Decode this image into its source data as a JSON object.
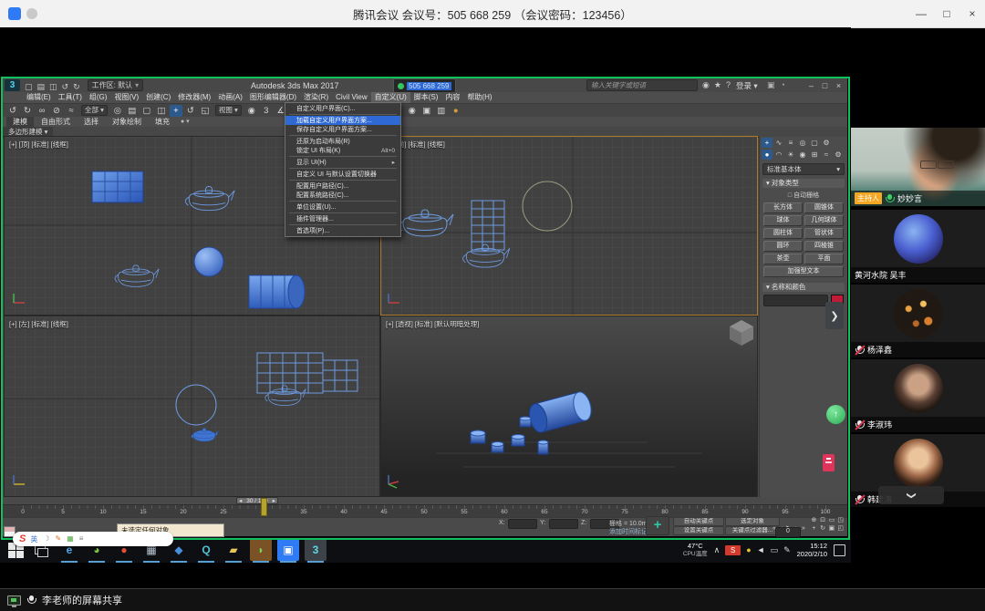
{
  "window": {
    "title": "腾讯会议 会议号：505 668 259 （会议密码：123456）",
    "controls": [
      {
        "n": "window-minimize-button",
        "g": "—"
      },
      {
        "n": "window-maximize-button",
        "g": "□"
      },
      {
        "n": "window-close-button",
        "g": "×"
      }
    ]
  },
  "share_bar": {
    "label": "李老师的屏幕共享"
  },
  "sidebar": {
    "participants": [
      {
        "name": "妙妙言",
        "badge": "主持人",
        "mic": "on",
        "kind": "video"
      },
      {
        "name": "黄河水院 吴丰",
        "mic": "none",
        "kind": "avatar",
        "avatar": "av1"
      },
      {
        "name": "杨泽鑫",
        "mic": "muted",
        "kind": "avatar",
        "avatar": "av2"
      },
      {
        "name": "李淑玮",
        "mic": "muted",
        "kind": "avatar",
        "avatar": "av3"
      },
      {
        "name": "韩建涛",
        "mic": "muted",
        "kind": "avatar",
        "avatar": "av4"
      }
    ],
    "expander_icon": "❯",
    "more_icon": "❯"
  },
  "max": {
    "title": "Autodesk 3ds Max 2017",
    "workspace": "工作区: 默认",
    "share_pill": "505 668 259",
    "search_placeholder": "输入关键字或短语",
    "signin": "登录 ▾",
    "quick_icons": [
      {
        "n": "new-file-icon",
        "g": "▢"
      },
      {
        "n": "open-file-icon",
        "g": "▤"
      },
      {
        "n": "save-file-icon",
        "g": "◫"
      },
      {
        "n": "undo-qat-icon",
        "g": "↺"
      },
      {
        "n": "redo-qat-icon",
        "g": "↻"
      }
    ],
    "account_icons": [
      {
        "n": "user-icon",
        "g": "◉"
      },
      {
        "n": "favorites-icon",
        "g": "★"
      },
      {
        "n": "help-icon",
        "g": "?"
      }
    ],
    "helper_icons": [
      {
        "n": "workspace-switcher-icon",
        "g": "▣"
      },
      {
        "n": "infocenter-icon",
        "g": "◔"
      }
    ],
    "window_controls": [
      {
        "n": "max-minimize-button",
        "g": "–"
      },
      {
        "n": "max-maximize-button",
        "g": "□"
      },
      {
        "n": "max-close-button",
        "g": "×"
      }
    ],
    "menubar": [
      "编辑(E)",
      "工具(T)",
      "组(G)",
      "视图(V)",
      "创建(C)",
      "修改器(M)",
      "动画(A)",
      "图形编辑器(D)",
      "渲染(R)",
      "Civil View",
      "自定义(U)",
      "脚本(S)",
      "内容",
      "帮助(H)"
    ],
    "open_menu_index": 10,
    "toolbar": [
      {
        "n": "undo-icon",
        "g": "↺"
      },
      {
        "n": "redo-icon",
        "g": "↻"
      },
      {
        "n": "select-and-link-icon",
        "g": "∞"
      },
      {
        "n": "unlink-selection-icon",
        "g": "⊘"
      },
      {
        "n": "bind-to-spacewarp-icon",
        "g": "≈"
      },
      {
        "n": "selection-filter-dropdown",
        "g": "全部",
        "dd": 1
      },
      {
        "n": "select-object-icon",
        "g": "◎"
      },
      {
        "n": "select-by-name-icon",
        "g": "▤"
      },
      {
        "n": "rectangular-region-icon",
        "g": "▢"
      },
      {
        "n": "window-crossing-icon",
        "g": "◫"
      },
      {
        "n": "select-and-move-icon",
        "g": "+",
        "hl": 1
      },
      {
        "n": "select-and-rotate-icon",
        "g": "↺"
      },
      {
        "n": "select-and-scale-icon",
        "g": "◱"
      },
      {
        "n": "reference-coordinate-dropdown",
        "g": "视图",
        "dd": 1
      },
      {
        "n": "use-pivot-icon",
        "g": "◉"
      },
      {
        "n": "snaps-toggle-icon",
        "g": "3"
      },
      {
        "n": "angle-snap-icon",
        "g": "∡"
      },
      {
        "n": "percent-snap-icon",
        "g": "%"
      },
      {
        "n": "named-selection-icon",
        "g": "▦"
      },
      {
        "n": "mirror-icon",
        "g": "◨"
      },
      {
        "n": "align-icon",
        "g": "≡"
      },
      {
        "n": "layer-manager-icon",
        "g": "▥"
      },
      {
        "n": "ribbon-toggle-icon",
        "g": "▬"
      },
      {
        "n": "curve-editor-icon",
        "g": "∿"
      },
      {
        "n": "schematic-view-icon",
        "g": "⊞"
      },
      {
        "n": "material-editor-icon",
        "g": "◉"
      },
      {
        "n": "render-setup-icon",
        "g": "▣"
      },
      {
        "n": "rendered-frame-icon",
        "g": "▥"
      },
      {
        "n": "render-production-icon",
        "g": "●",
        "c": "#d49a3a"
      }
    ],
    "ribbon_tabs": [
      "建模",
      "自由形式",
      "选择",
      "对象绘制",
      "填充"
    ],
    "ribbon_panel": "多边形建模 ▾",
    "customize_menu": [
      {
        "label": "自定义用户界面(C)...",
        "sep_after": true
      },
      {
        "label": "加载自定义用户界面方案...",
        "highlight": true
      },
      {
        "label": "保存自定义用户界面方案...",
        "sep_after": true
      },
      {
        "label": "还原为启动布局(R)"
      },
      {
        "label": "锁定 UI 布局(K)",
        "shortcut": "Alt+0",
        "sep_after": true
      },
      {
        "label": "显示 UI(H)",
        "submenu": true,
        "sep_after": true
      },
      {
        "label": "自定义 UI 与默认设置切换器",
        "sep_after": true
      },
      {
        "label": "配置用户路径(C)..."
      },
      {
        "label": "配置系统路径(C)...",
        "sep_after": true
      },
      {
        "label": "单位设置(U)...",
        "sep_after": true
      },
      {
        "label": "插件管理器...",
        "sep_after": true
      },
      {
        "label": "首选项(P)..."
      }
    ],
    "viewport_labels": {
      "tl": "[+] [顶] [标准] [线框]",
      "tr": "[+] [前] [标准] [线框]",
      "bl": "[+] [左] [标准] [线框]",
      "br": "[+] [透视] [标准] [默认明暗处理]"
    },
    "command_panel": {
      "row1": [
        {
          "n": "create-tab-icon",
          "g": "+",
          "on": 1
        },
        {
          "n": "modify-tab-icon",
          "g": "∿"
        },
        {
          "n": "hierarchy-tab-icon",
          "g": "≡"
        },
        {
          "n": "motion-tab-icon",
          "g": "◎"
        },
        {
          "n": "display-tab-icon",
          "g": "▢"
        },
        {
          "n": "utilities-tab-icon",
          "g": "⚙"
        }
      ],
      "row2": [
        {
          "n": "geometry-icon",
          "g": "●",
          "on": 1
        },
        {
          "n": "shapes-icon",
          "g": "◠"
        },
        {
          "n": "lights-icon",
          "g": "☀"
        },
        {
          "n": "cameras-icon",
          "g": "◉"
        },
        {
          "n": "helpers-icon",
          "g": "⊞"
        },
        {
          "n": "spacewarps-icon",
          "g": "≈"
        },
        {
          "n": "systems-icon",
          "g": "⚙"
        }
      ],
      "category": "标准基本体",
      "rollout_object_type": "对象类型",
      "autogrid": "自动栅格",
      "buttons": [
        "长方体",
        "圆锥体",
        "球体",
        "几何球体",
        "圆柱体",
        "管状体",
        "圆环",
        "四棱锥",
        "茶壶",
        "平面"
      ],
      "wide_button": "加强型文本",
      "rollout_name_color": "名称和颜色",
      "swatch_color": "#c01c3a"
    },
    "timeline": {
      "handle": "30 / 100",
      "tick_step": 5,
      "tick_max": 100
    },
    "status": {
      "prompt": "未选定任何对象",
      "x_label": "X:",
      "y_label": "Y:",
      "z_label": "Z:",
      "grid": "栅格 = 10.0mm",
      "add_time_tag": "添加时间标记",
      "auto_key": "自动关键点",
      "selected": "选定对象",
      "set_key": "设置关键点",
      "key_filters": "关键点过滤器...",
      "frame": "0",
      "playback": [
        {
          "n": "go-to-start-icon",
          "g": "«"
        },
        {
          "n": "previous-frame-icon",
          "g": "‹"
        },
        {
          "n": "play-icon",
          "g": "▶"
        },
        {
          "n": "next-frame-icon",
          "g": "›"
        },
        {
          "n": "go-to-end-icon",
          "g": "»"
        }
      ],
      "nav": [
        {
          "n": "zoom-icon",
          "g": "⊕"
        },
        {
          "n": "zoom-all-icon",
          "g": "⊡"
        },
        {
          "n": "zoom-extents-icon",
          "g": "▭"
        },
        {
          "n": "fov-icon",
          "g": "◳"
        },
        {
          "n": "pan-icon",
          "g": "+"
        },
        {
          "n": "orbit-icon",
          "g": "↻"
        },
        {
          "n": "maximize-viewport-icon",
          "g": "▣"
        },
        {
          "n": "region-zoom-icon",
          "g": "◰"
        }
      ]
    }
  },
  "sogou": {
    "logo": "S",
    "icons": [
      {
        "n": "sogou-lang-icon",
        "g": "英",
        "c": "#3a6fd0"
      },
      {
        "n": "sogou-moon-icon",
        "g": "☽",
        "c": "#888888"
      },
      {
        "n": "sogou-pen-icon",
        "g": "✎",
        "c": "#e06a2a"
      },
      {
        "n": "sogou-keyboard-icon",
        "g": "▦",
        "c": "#58a848"
      },
      {
        "n": "sogou-toolbox-icon",
        "g": "≡",
        "c": "#777777"
      }
    ]
  },
  "taskbar": {
    "apps": [
      {
        "n": "taskbar-edge",
        "g": "e",
        "fg": "#4aa8e8"
      },
      {
        "n": "taskbar-360",
        "g": "◕",
        "fg": "#7dc242"
      },
      {
        "n": "taskbar-app-red",
        "g": "●",
        "fg": "#e05039"
      },
      {
        "n": "taskbar-app-gray",
        "g": "▦",
        "fg": "#b8c4d0"
      },
      {
        "n": "taskbar-app-blue",
        "g": "◆",
        "fg": "#4a8fd9"
      },
      {
        "n": "taskbar-search",
        "g": "Q",
        "fg": "#52c0d8"
      },
      {
        "n": "taskbar-folder",
        "g": "▰",
        "fg": "#e8c558"
      },
      {
        "n": "taskbar-wechat",
        "g": "◗",
        "fg": "#6ede5a",
        "tile": "#7a5226"
      },
      {
        "n": "taskbar-meeting",
        "g": "▣",
        "fg": "#ffffff",
        "tile": "#2f7bf5"
      },
      {
        "n": "taskbar-3dsmax",
        "g": "3",
        "fg": "#5ad8e8",
        "tile": "#3d4148"
      }
    ],
    "tray": {
      "temp": "47°C",
      "temp_label": "CPU温度",
      "icons": [
        {
          "n": "chevron-up-icon",
          "g": "∧"
        },
        {
          "n": "sogou-tray-icon",
          "g": "S",
          "badge": 1
        },
        {
          "n": "status-dot-icon",
          "g": "●",
          "c": "#e8c32a"
        },
        {
          "n": "volume-icon",
          "g": "◄"
        },
        {
          "n": "display-tray-icon",
          "g": "▭"
        },
        {
          "n": "pen-tray-icon",
          "g": "✎"
        }
      ],
      "time": "15:12",
      "date": "2020/2/10"
    }
  }
}
